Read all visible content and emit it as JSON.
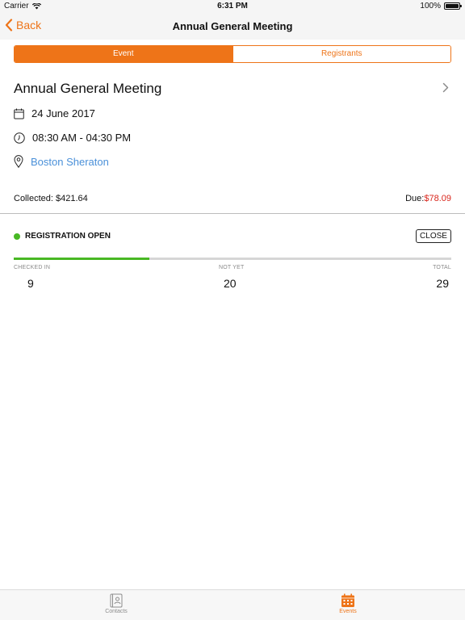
{
  "status_bar": {
    "carrier": "Carrier",
    "time": "6:31 PM",
    "battery_text": "100%",
    "battery_level": 1.0
  },
  "nav": {
    "back_label": "Back",
    "title": "Annual General Meeting"
  },
  "segments": {
    "event": "Event",
    "registrants": "Registrants",
    "selected": "Event"
  },
  "event": {
    "title": "Annual General Meeting",
    "date": "24 June 2017",
    "time": "08:30 AM - 04:30 PM",
    "venue": "Boston Sheraton"
  },
  "payment": {
    "collected_label": "Collected:",
    "collected_value": "$421.64",
    "due_label": "Due:",
    "due_value": "$78.09"
  },
  "registration": {
    "status": "REGISTRATION OPEN",
    "close_label": "CLOSE",
    "progress_fraction": 0.31,
    "checked_in_label": "CHECKED IN",
    "checked_in_value": "9",
    "not_yet_label": "NOT YET",
    "not_yet_value": "20",
    "total_label": "TOTAL",
    "total_value": "29"
  },
  "tab_bar": {
    "contacts_label": "Contacts",
    "events_label": "Events",
    "selected": "Events"
  },
  "colors": {
    "accent": "#ee7418",
    "link": "#4a90d9",
    "due": "#d9261c",
    "status_green": "#48b824"
  },
  "icons": {
    "back": "chevron-left-icon",
    "detail": "chevron-right-icon",
    "date": "calendar-icon",
    "time": "clock-icon",
    "venue": "location-pin-icon",
    "contacts": "contacts-book-icon",
    "events": "events-calendar-icon"
  }
}
